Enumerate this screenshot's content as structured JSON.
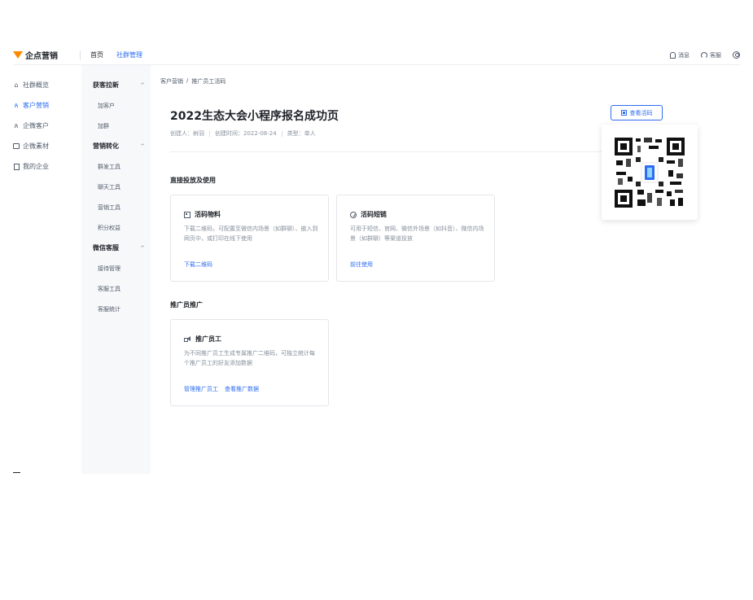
{
  "topbar": {
    "brand": "企点营销",
    "nav": [
      "首页",
      "社群管理"
    ],
    "active_nav_index": 1,
    "right": {
      "message": "消息",
      "service": "客服"
    }
  },
  "sidebar": {
    "items": [
      {
        "label": "社群概览",
        "icon": "home-icon",
        "active": false
      },
      {
        "label": "客户营销",
        "icon": "users-icon",
        "active": true
      },
      {
        "label": "企微客户",
        "icon": "user-icon",
        "active": false
      },
      {
        "label": "企微素材",
        "icon": "folder-icon",
        "active": false
      },
      {
        "label": "我的企业",
        "icon": "building-icon",
        "active": false
      }
    ]
  },
  "subnav": {
    "groups": [
      {
        "label": "获客拉新",
        "items": [
          "加客户",
          "加群"
        ]
      },
      {
        "label": "营销转化",
        "items": [
          "群发工具",
          "聊天工具",
          "营销工具",
          "积分权益"
        ]
      },
      {
        "label": "微信客服",
        "items": [
          "接待管理",
          "客服工具",
          "客服统计"
        ]
      }
    ]
  },
  "breadcrumb": [
    "客户营销",
    "/",
    "推广员工活码"
  ],
  "page": {
    "title": "2022生态大会小程序报名成功页",
    "meta": {
      "creator": "创建人：树羽",
      "created": "创建时间：2022-08-24",
      "type": "类型：单人"
    },
    "view_qr_button": "查看活码"
  },
  "sections": {
    "direct": {
      "title": "直接投放及使用",
      "cards": [
        {
          "title": "活码物料",
          "icon": "qr-material-icon",
          "desc": "下载二维码，可配置至微信内场景（如群聊）、嵌入到网页中，或打印在线下使用",
          "links": [
            "下载二维码"
          ]
        },
        {
          "title": "活码短链",
          "icon": "link-icon",
          "desc": "可用于短信、官网、微信外场景（如抖音）、微信内场景（如群聊）等渠道投放",
          "links": [
            "前往使用"
          ]
        }
      ]
    },
    "promoter": {
      "title": "推广员推广",
      "cards": [
        {
          "title": "推广员工",
          "icon": "speaker-icon",
          "desc": "为不同推广员工生成专属推广二维码，可独立统计每个推广员工的好友添加数据",
          "links": [
            "管理推广员工",
            "查看推广数据"
          ]
        }
      ]
    }
  },
  "colors": {
    "accent": "#2d6cf2",
    "brand": "#ff8a00",
    "subnav_bg": "#f7f8fa"
  }
}
